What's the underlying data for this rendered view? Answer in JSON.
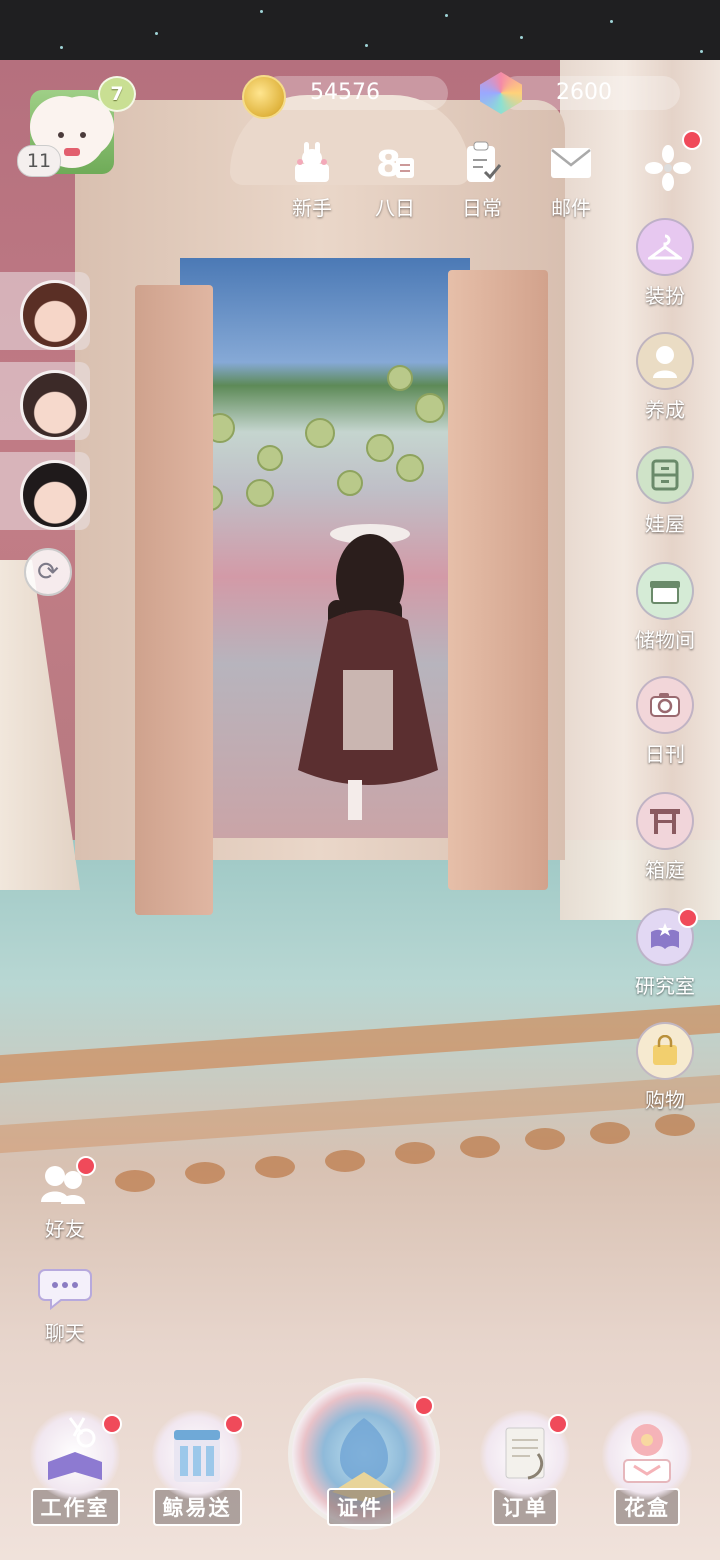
{
  "player": {
    "level": "11",
    "vip": "7"
  },
  "currency": {
    "coins": "54576",
    "gems": "2600"
  },
  "top_menu": [
    {
      "label": "新手",
      "icon": "bunny-basket-icon"
    },
    {
      "label": "八日",
      "icon": "eight-days-icon"
    },
    {
      "label": "日常",
      "icon": "clipboard-check-icon"
    },
    {
      "label": "邮件",
      "icon": "mail-icon"
    }
  ],
  "right_menu": [
    {
      "label": "装扮",
      "icon": "hanger-icon"
    },
    {
      "label": "养成",
      "icon": "doll-icon"
    },
    {
      "label": "娃屋",
      "icon": "cabinet-icon"
    },
    {
      "label": "储物间",
      "icon": "storage-box-icon"
    },
    {
      "label": "日刊",
      "icon": "camera-icon"
    },
    {
      "label": "箱庭",
      "icon": "shrine-icon"
    },
    {
      "label": "研究室",
      "icon": "book-star-icon"
    },
    {
      "label": "购物",
      "icon": "shopping-bag-icon"
    }
  ],
  "left_menu": [
    {
      "label": "好友",
      "icon": "friends-icon"
    },
    {
      "label": "聊天",
      "icon": "chat-bubble-icon"
    }
  ],
  "bottom_menu": [
    {
      "label": "工作室",
      "icon": "scissors-book-icon"
    },
    {
      "label": "鲸易送",
      "icon": "shop-stall-icon"
    },
    {
      "label": "证件",
      "icon": "certificate-emblem-icon"
    },
    {
      "label": "订单",
      "icon": "order-scroll-icon"
    },
    {
      "label": "花盒",
      "icon": "flower-box-icon"
    }
  ],
  "colors": {
    "notification": "#f04a5a",
    "label": "#ffffff"
  }
}
